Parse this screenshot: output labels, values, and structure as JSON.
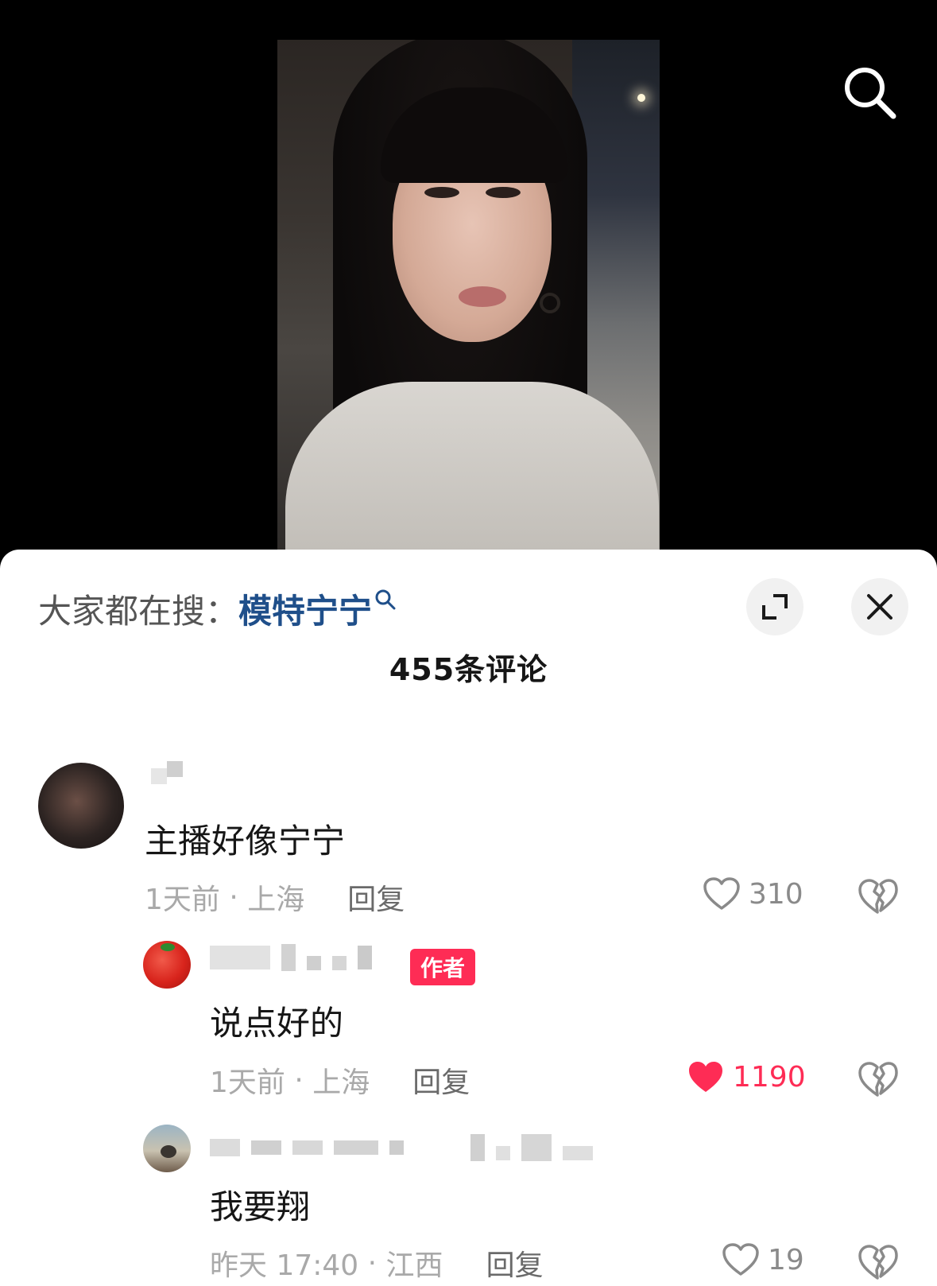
{
  "sheet": {
    "hot_search_prefix": "大家都在搜：",
    "hot_search_keyword": "模特宁宁",
    "comment_count_label": "455条评论"
  },
  "comments": [
    {
      "text": "主播好像宁宁",
      "time": "1天前",
      "location": "上海",
      "reply_label": "回复",
      "likes": "310",
      "liked": false
    },
    {
      "badge": "作者",
      "text": "说点好的",
      "time": "1天前",
      "location": "上海",
      "reply_label": "回复",
      "likes": "1190",
      "liked": true
    },
    {
      "text": "我要翔",
      "time": "昨天 17:40",
      "location": "江西",
      "reply_label": "回复",
      "likes": "19",
      "liked": false
    }
  ],
  "colors": {
    "accent_red": "#fe2c55",
    "keyword_blue": "#1f4f8a"
  },
  "icons": [
    "search-icon",
    "expand-icon",
    "close-icon",
    "heart-icon",
    "heart-filled-icon",
    "dislike-icon",
    "magnifier-small-icon"
  ]
}
